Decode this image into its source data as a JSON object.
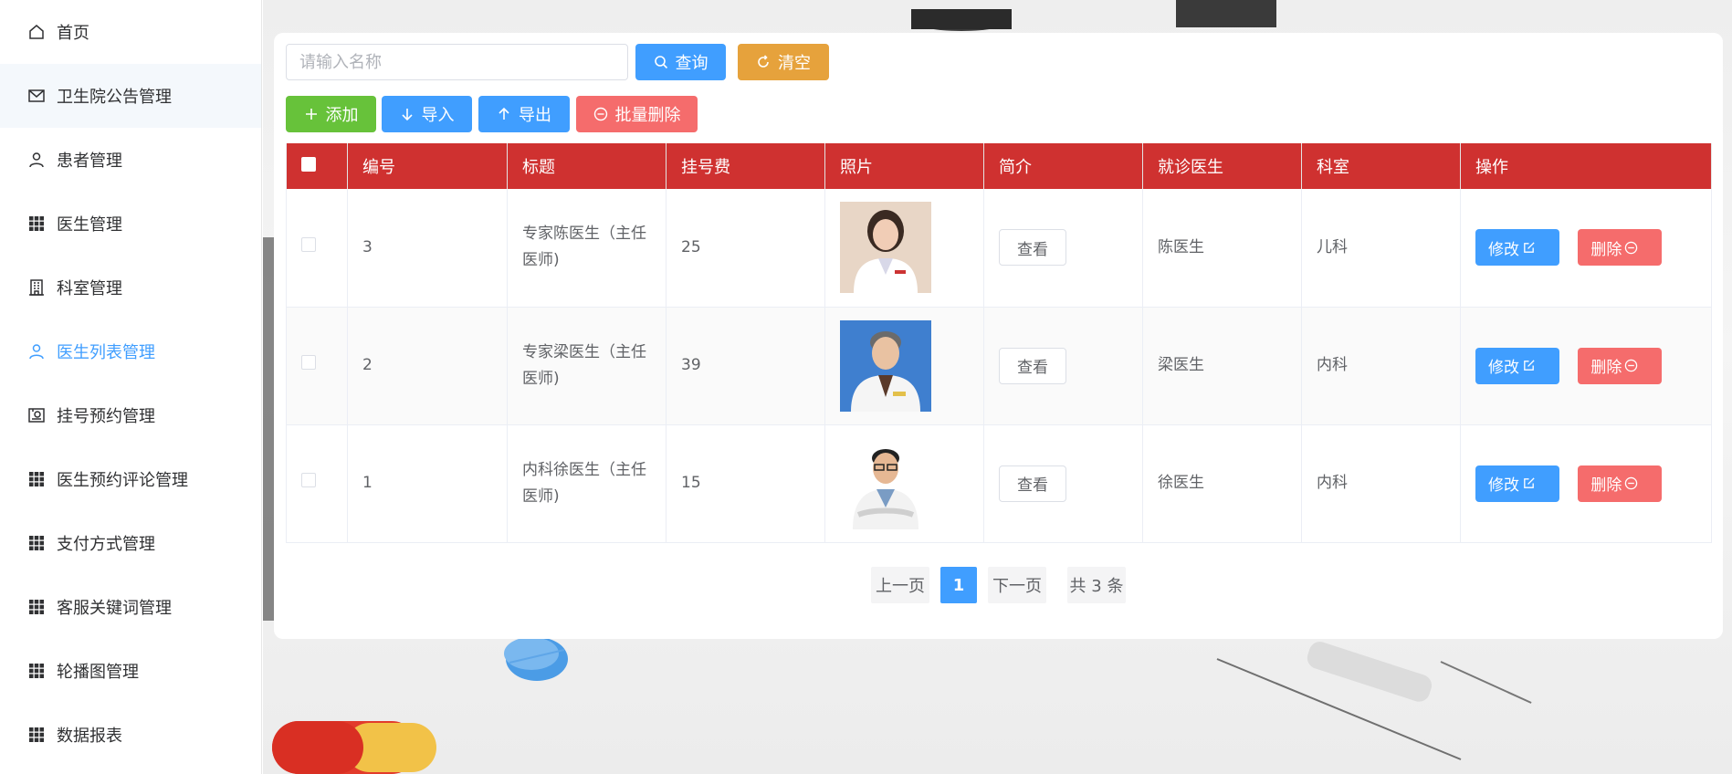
{
  "sidebar": {
    "items": [
      {
        "label": "首页",
        "icon": "home-icon"
      },
      {
        "label": "卫生院公告管理",
        "icon": "message-icon"
      },
      {
        "label": "患者管理",
        "icon": "user-icon"
      },
      {
        "label": "医生管理",
        "icon": "grid-icon"
      },
      {
        "label": "科室管理",
        "icon": "office-building-icon"
      },
      {
        "label": "医生列表管理",
        "icon": "user-icon"
      },
      {
        "label": "挂号预约管理",
        "icon": "postcard-icon"
      },
      {
        "label": "医生预约评论管理",
        "icon": "grid-icon"
      },
      {
        "label": "支付方式管理",
        "icon": "grid-icon"
      },
      {
        "label": "客服关键词管理",
        "icon": "grid-icon"
      },
      {
        "label": "轮播图管理",
        "icon": "grid-icon"
      },
      {
        "label": "数据报表",
        "icon": "grid-icon"
      }
    ],
    "active_color": "#409eff"
  },
  "search": {
    "placeholder": "请输入名称",
    "query_label": "查询",
    "clear_label": "清空"
  },
  "toolbar": {
    "add_label": "添加",
    "import_label": "导入",
    "export_label": "导出",
    "batch_delete_label": "批量删除"
  },
  "table": {
    "header_color": "#cf3130",
    "columns": [
      "编号",
      "标题",
      "挂号费",
      "照片",
      "简介",
      "就诊医生",
      "科室",
      "操作"
    ],
    "rows": [
      {
        "id": "3",
        "title": "专家陈医生（主任医师)",
        "fee": "25",
        "view": "查看",
        "doctor": "陈医生",
        "dept": "儿科",
        "edit": "修改",
        "delete": "删除"
      },
      {
        "id": "2",
        "title": "专家梁医生（主任医师)",
        "fee": "39",
        "view": "查看",
        "doctor": "梁医生",
        "dept": "内科",
        "edit": "修改",
        "delete": "删除"
      },
      {
        "id": "1",
        "title": "内科徐医生（主任医师)",
        "fee": "15",
        "view": "查看",
        "doctor": "徐医生",
        "dept": "内科",
        "edit": "修改",
        "delete": "删除"
      }
    ]
  },
  "pagination": {
    "prev": "上一页",
    "current": "1",
    "next": "下一页",
    "total": "共 3 条"
  }
}
